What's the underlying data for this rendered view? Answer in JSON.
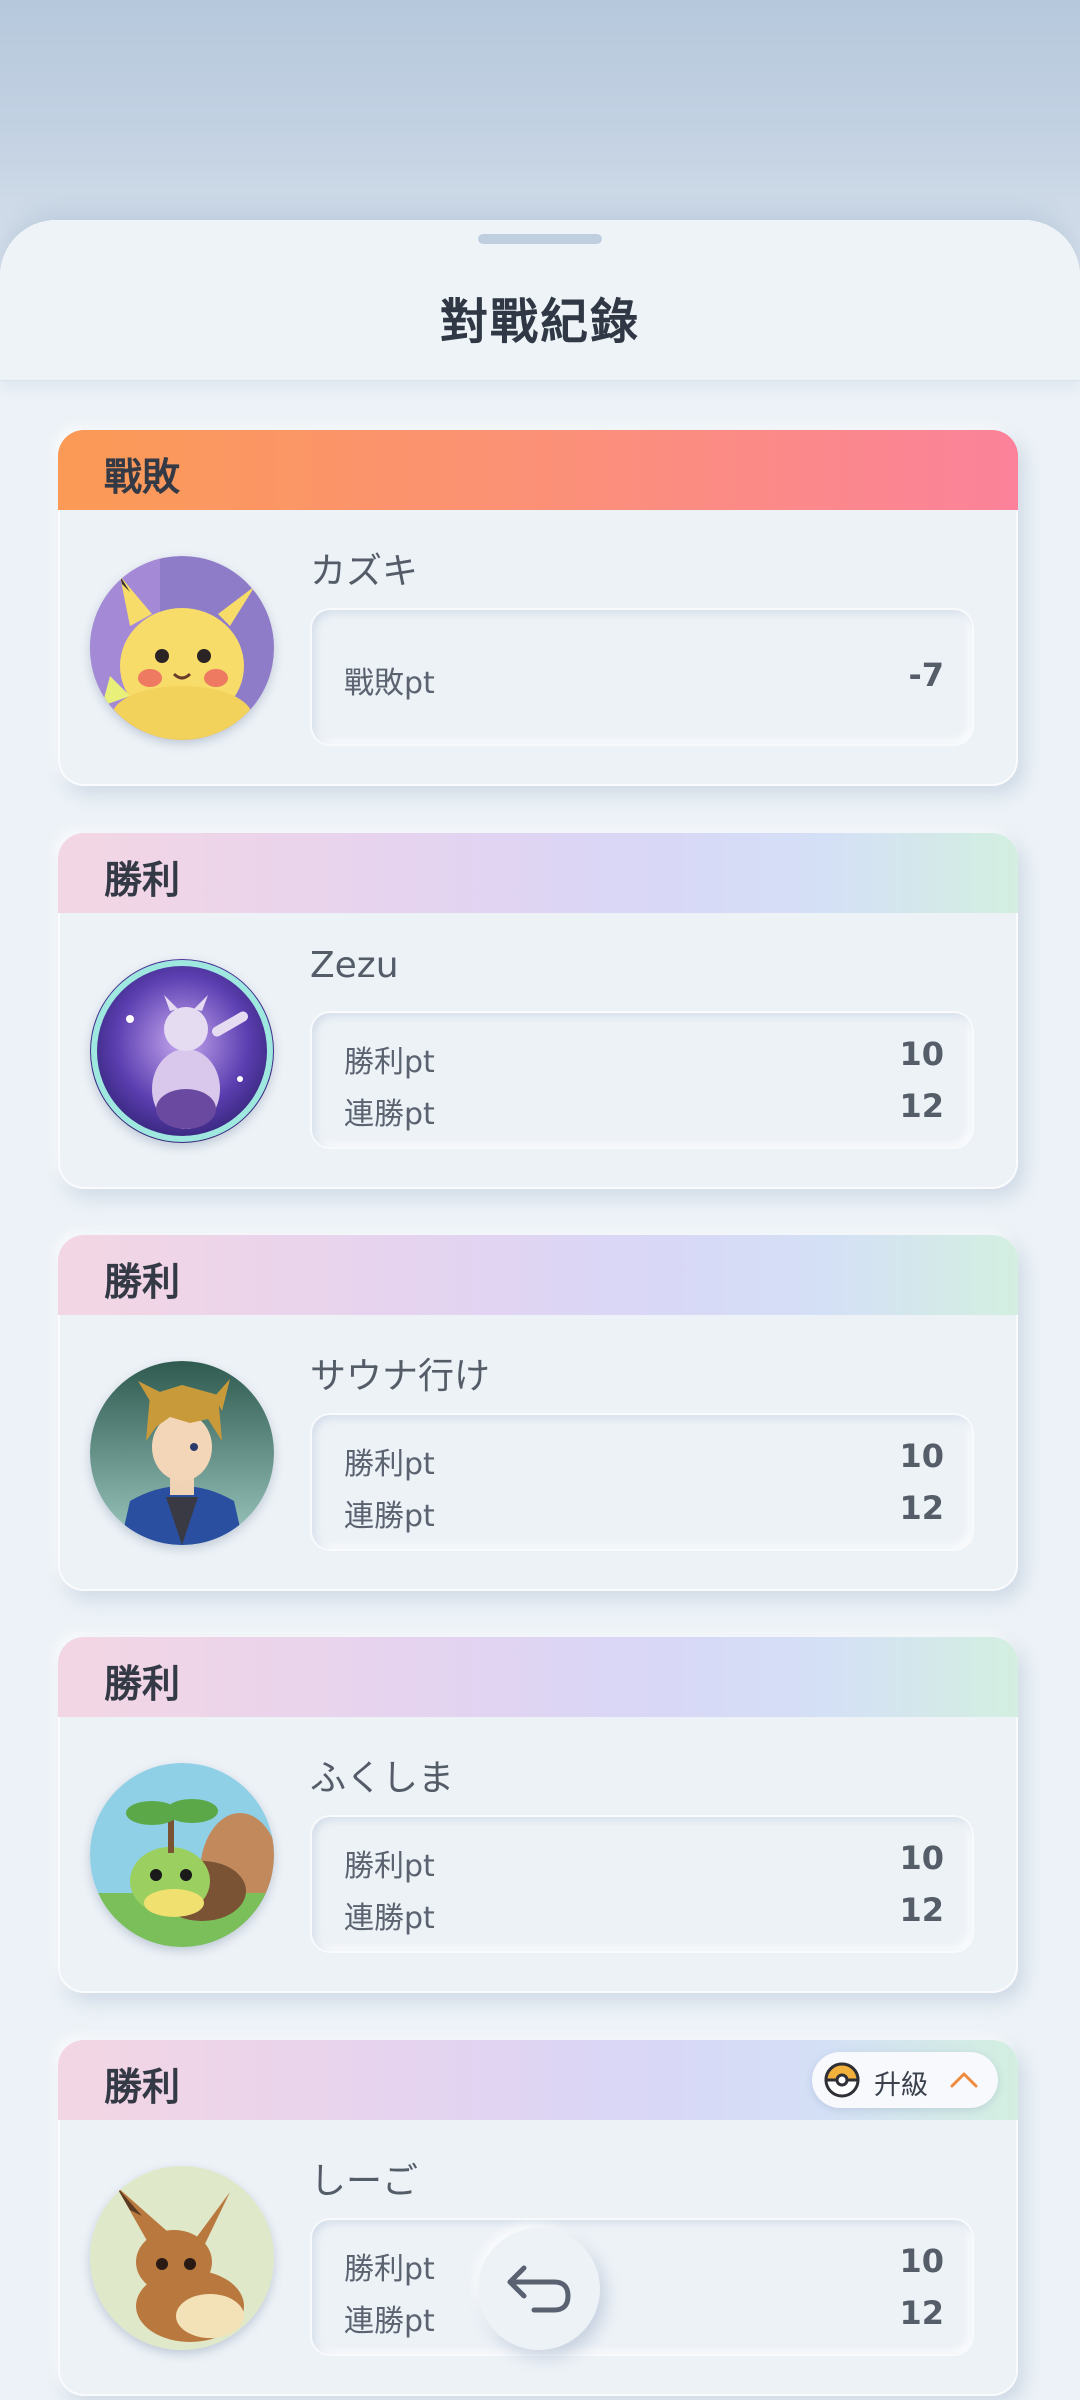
{
  "header": {
    "title": "對戰紀錄"
  },
  "records": [
    {
      "result": "戰敗",
      "player": "カズキ",
      "stats": [
        {
          "label": "戰敗pt",
          "value": "-7"
        }
      ],
      "avatar": "pikachu"
    },
    {
      "result": "勝利",
      "player": "Zezu",
      "stats": [
        {
          "label": "勝利pt",
          "value": "10"
        },
        {
          "label": "連勝pt",
          "value": "12"
        }
      ],
      "avatar": "mewtwo"
    },
    {
      "result": "勝利",
      "player": "サウナ行け",
      "stats": [
        {
          "label": "勝利pt",
          "value": "10"
        },
        {
          "label": "連勝pt",
          "value": "12"
        }
      ],
      "avatar": "trainer"
    },
    {
      "result": "勝利",
      "player": "ふくしま",
      "stats": [
        {
          "label": "勝利pt",
          "value": "10"
        },
        {
          "label": "連勝pt",
          "value": "12"
        }
      ],
      "avatar": "turtwig"
    },
    {
      "result": "勝利",
      "player": "しーご",
      "stats": [
        {
          "label": "勝利pt",
          "value": "10"
        },
        {
          "label": "連勝pt",
          "value": "12"
        }
      ],
      "avatar": "eevee"
    }
  ],
  "upgrade": {
    "label": "升級",
    "icon": "pokeball-icon"
  },
  "back_button": {
    "icon": "return-arrow-icon"
  },
  "colors": {
    "loss_band": "#fb9273",
    "win_band": "#e6d3ef",
    "accent": "#f08a3c"
  }
}
